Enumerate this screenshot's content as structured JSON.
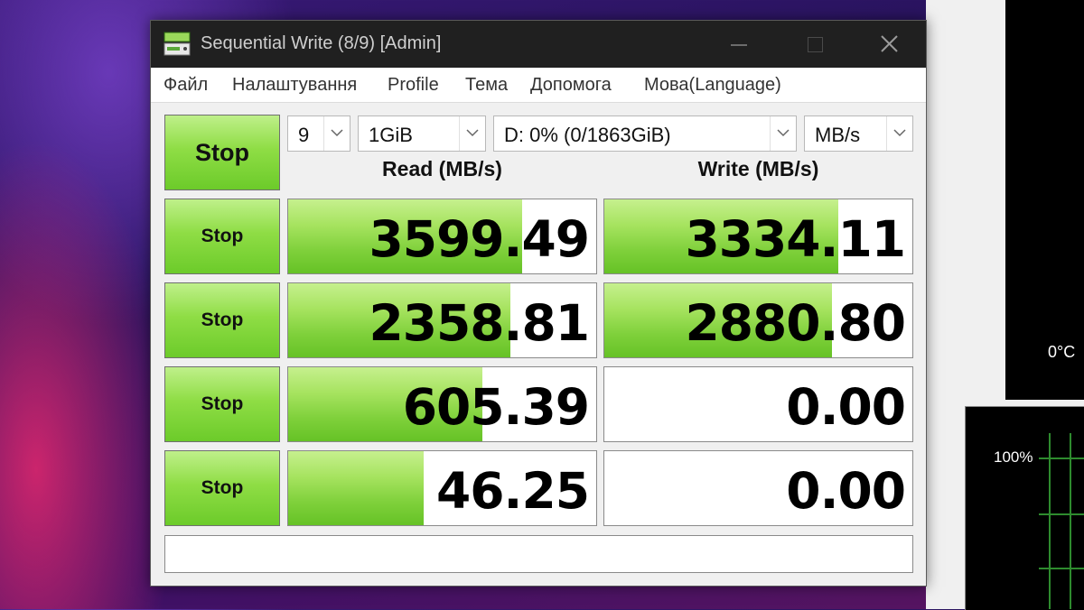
{
  "window": {
    "title": "Sequential Write (8/9) [Admin]"
  },
  "menu": [
    "Файл",
    "Налаштування",
    "Profile",
    "Тема",
    "Допомога",
    "Мова(Language)"
  ],
  "controls": {
    "main_button": "Stop",
    "count": "9",
    "size": "1GiB",
    "drive": "D: 0% (0/1863GiB)",
    "unit": "MB/s"
  },
  "headers": {
    "read": "Read (MB/s)",
    "write": "Write (MB/s)"
  },
  "rows": [
    {
      "button": "Stop",
      "read": "3599.49",
      "write": "3334.11",
      "read_fill": 0.76,
      "write_fill": 0.76
    },
    {
      "button": "Stop",
      "read": "2358.81",
      "write": "2880.80",
      "read_fill": 0.72,
      "write_fill": 0.74
    },
    {
      "button": "Stop",
      "read": "605.39",
      "write": "0.00",
      "read_fill": 0.63,
      "write_fill": 0
    },
    {
      "button": "Stop",
      "read": "46.25",
      "write": "0.00",
      "read_fill": 0.44,
      "write_fill": 0
    }
  ],
  "status_text": "",
  "background_app": {
    "temp_label": "0°C",
    "percent_label": "100%"
  },
  "colors": {
    "accent_green": "#7ed03a",
    "titlebar": "#202020"
  }
}
